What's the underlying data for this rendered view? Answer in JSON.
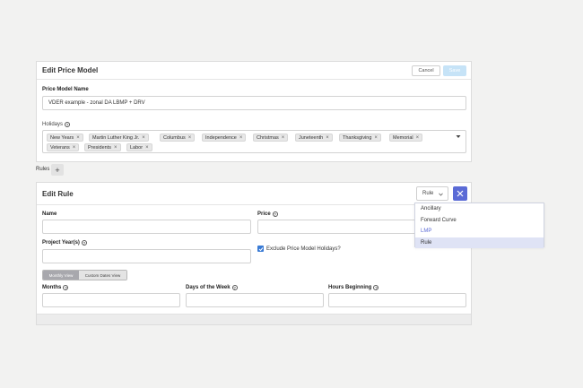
{
  "price_model": {
    "title": "Edit Price Model",
    "cancel_label": "Cancel",
    "save_label": "Save",
    "name_label": "Price Model Name",
    "name_value": "VDER example - zonal DA LBMP + DRV",
    "holidays_label": "Holidays",
    "holidays": [
      "New Years",
      "Martin Luther King Jr.",
      "Columbus",
      "Independence",
      "Christmas",
      "Juneteenth",
      "Thanksgiving",
      "Memorial",
      "Veterans",
      "Presidents",
      "Labor"
    ]
  },
  "rules": {
    "label": "Rules",
    "add_symbol": "+"
  },
  "edit_rule": {
    "title": "Edit Rule",
    "type_value": "Rule",
    "type_options": [
      "Ancillary",
      "Forward Curve",
      "LMP",
      "Rule"
    ],
    "name_label": "Name",
    "price_label": "Price",
    "project_years_label": "Project Year(s)",
    "exclude_holidays_label": "Exclude Price Model Holidays?",
    "exclude_holidays_checked": true,
    "view_tabs": [
      "Monthly View",
      "Custom Dates View"
    ],
    "months_label": "Months",
    "days_label": "Days of the Week",
    "hours_label": "Hours Beginning"
  },
  "colors": {
    "accent": "#5b6bd6",
    "checkbox": "#3a7bd5",
    "save_disabled": "#c6e3f7"
  }
}
